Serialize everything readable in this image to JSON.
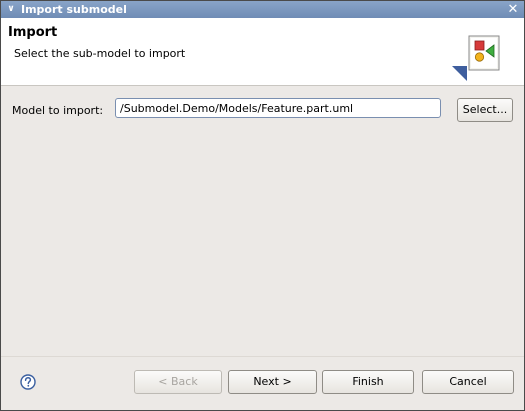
{
  "window": {
    "title": "Import submodel",
    "menu_glyph": "∨",
    "close_glyph": "✕"
  },
  "header": {
    "heading": "Import",
    "description": "Select the sub-model to import",
    "icon": "import-wizard-icon"
  },
  "form": {
    "model_label": "Model to import:",
    "model_value": "/Submodel.Demo/Models/Feature.part.uml",
    "select_label": "Select..."
  },
  "buttons": {
    "back": "< Back",
    "next": "Next >",
    "finish": "Finish",
    "cancel": "Cancel",
    "help_icon": "help-icon"
  },
  "colors": {
    "titlebar": "#7b96be",
    "dialog_bg": "#ece9e6",
    "header_bg": "#ffffff"
  }
}
